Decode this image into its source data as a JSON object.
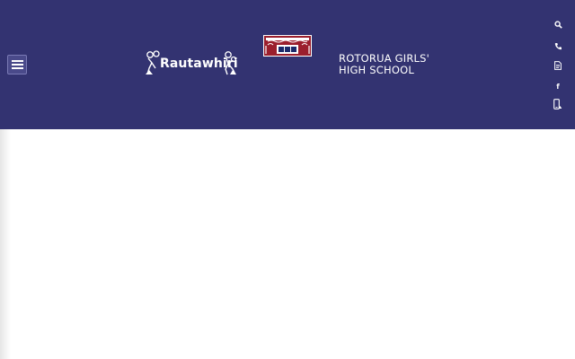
{
  "header": {
    "background_color": "#333371",
    "menu_icon": "hamburger-menu-icon",
    "rautawhiri_logo_text": "Rautawhiri",
    "crest_icon": "school-crest-icon",
    "school_name_line1": "ROTORUA GIRLS'",
    "school_name_line2": "HIGH SCHOOL"
  },
  "side_icons": {
    "search_icon": "search-icon",
    "phone_icon": "phone-icon",
    "document_icon": "document-icon",
    "facebook_label": "f",
    "mobile_icon": "mobile-app-icon"
  }
}
